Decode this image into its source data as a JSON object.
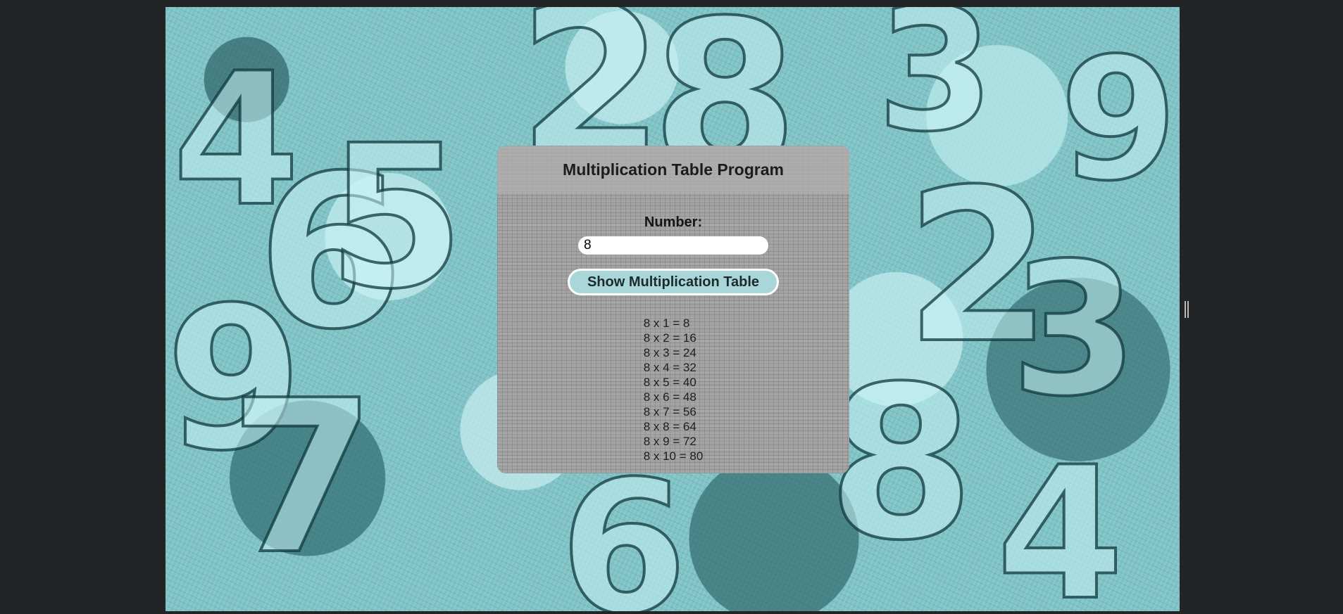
{
  "app": {
    "title": "Multiplication Table Program"
  },
  "form": {
    "number_label": "Number:",
    "number_value": "8",
    "button_label": "Show Multiplication Table"
  },
  "results": [
    "8 x 1 = 8",
    "8 x 2 = 16",
    "8 x 3 = 24",
    "8 x 4 = 32",
    "8 x 5 = 40",
    "8 x 6 = 48",
    "8 x 7 = 56",
    "8 x 8 = 64",
    "8 x 9 = 72",
    "8 x 10 = 80"
  ],
  "colors": {
    "page_background": "#232426",
    "wallpaper_teal": "#7fc3c7",
    "panel_gray": "#a3a3a3",
    "button_teal": "#a9d7d9"
  }
}
